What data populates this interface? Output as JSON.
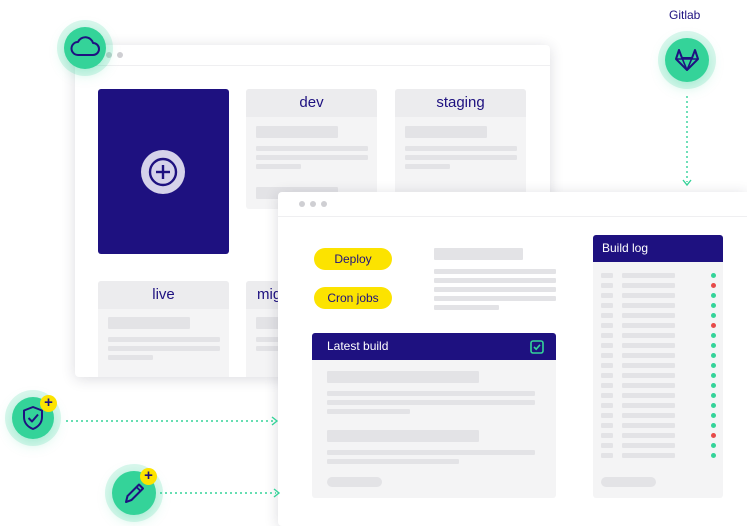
{
  "integration": {
    "label": "Gitlab"
  },
  "back_window": {
    "cards": [
      {
        "label": "dev"
      },
      {
        "label": "staging"
      },
      {
        "label": "live"
      },
      {
        "label": "mig"
      }
    ]
  },
  "front_window": {
    "buttons": {
      "deploy": "Deploy",
      "cron": "Cron jobs"
    },
    "latest_build": {
      "title": "Latest build"
    },
    "build_log": {
      "title": "Build log",
      "statuses": [
        "ok",
        "error",
        "ok",
        "ok",
        "ok",
        "error",
        "ok",
        "ok",
        "ok",
        "ok",
        "ok",
        "ok",
        "ok",
        "ok",
        "ok",
        "ok",
        "error",
        "ok",
        "ok"
      ]
    }
  },
  "colors": {
    "navy": "#1e1180",
    "green": "#34d399",
    "yellow": "#fce300",
    "error": "#e34b4b"
  },
  "icons": [
    "cloud-icon",
    "gitlab-icon",
    "shield-check-icon",
    "pencil-icon",
    "plus-circle-icon",
    "checkbox-icon"
  ]
}
